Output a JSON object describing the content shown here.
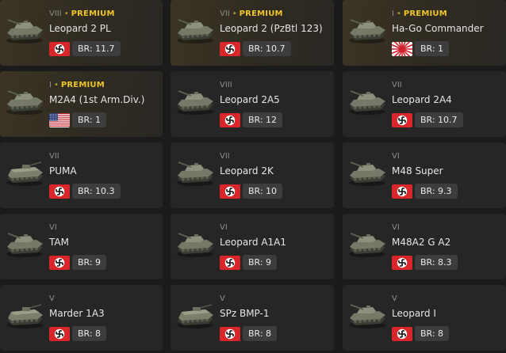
{
  "premium_label": "PREMIUM",
  "colors": {
    "premium_accent": "#f0c52a",
    "card_bg": "#262626",
    "premium_card_bg": "#3c3524",
    "br_badge_bg": "#3d3d3d",
    "page_bg": "#1b1b1b"
  },
  "vehicles": [
    {
      "rank": "VIII",
      "premium": true,
      "name": "Leopard 2 PL",
      "flag": "germany-flag-icon",
      "br": "BR: 11.7",
      "icon": "tank-icon"
    },
    {
      "rank": "VII",
      "premium": true,
      "name": "Leopard 2 (PzBtl 123)",
      "flag": "germany-flag-icon",
      "br": "BR: 10.7",
      "icon": "tank-icon"
    },
    {
      "rank": "I",
      "premium": true,
      "name": "Ha-Go Commander",
      "flag": "japan-flag-icon",
      "br": "BR: 1",
      "icon": "tank-icon"
    },
    {
      "rank": "I",
      "premium": true,
      "name": "M2A4 (1st Arm.Div.)",
      "flag": "usa-flag-icon",
      "br": "BR: 1",
      "icon": "tank-icon"
    },
    {
      "rank": "VIII",
      "premium": false,
      "name": "Leopard 2A5",
      "flag": "germany-flag-icon",
      "br": "BR: 12",
      "icon": "tank-icon"
    },
    {
      "rank": "VII",
      "premium": false,
      "name": "Leopard 2A4",
      "flag": "germany-flag-icon",
      "br": "BR: 10.7",
      "icon": "tank-icon"
    },
    {
      "rank": "VII",
      "premium": false,
      "name": "PUMA",
      "flag": "germany-flag-icon",
      "br": "BR: 10.3",
      "icon": "ifv-icon"
    },
    {
      "rank": "VII",
      "premium": false,
      "name": "Leopard 2K",
      "flag": "germany-flag-icon",
      "br": "BR: 10",
      "icon": "tank-icon"
    },
    {
      "rank": "VI",
      "premium": false,
      "name": "M48 Super",
      "flag": "germany-flag-icon",
      "br": "BR: 9.3",
      "icon": "tank-icon"
    },
    {
      "rank": "VI",
      "premium": false,
      "name": "TAM",
      "flag": "germany-flag-icon",
      "br": "BR: 9",
      "icon": "tank-icon"
    },
    {
      "rank": "VI",
      "premium": false,
      "name": "Leopard A1A1",
      "flag": "germany-flag-icon",
      "br": "BR: 9",
      "icon": "tank-icon"
    },
    {
      "rank": "VI",
      "premium": false,
      "name": "M48A2 G A2",
      "flag": "germany-flag-icon",
      "br": "BR: 8.3",
      "icon": "tank-icon"
    },
    {
      "rank": "V",
      "premium": false,
      "name": "Marder 1A3",
      "flag": "germany-flag-icon",
      "br": "BR: 8",
      "icon": "ifv-icon"
    },
    {
      "rank": "V",
      "premium": false,
      "name": "SPz BMP-1",
      "flag": "germany-flag-icon",
      "br": "BR: 8",
      "icon": "ifv-icon"
    },
    {
      "rank": "V",
      "premium": false,
      "name": "Leopard I",
      "flag": "germany-flag-icon",
      "br": "BR: 8",
      "icon": "tank-icon"
    }
  ]
}
